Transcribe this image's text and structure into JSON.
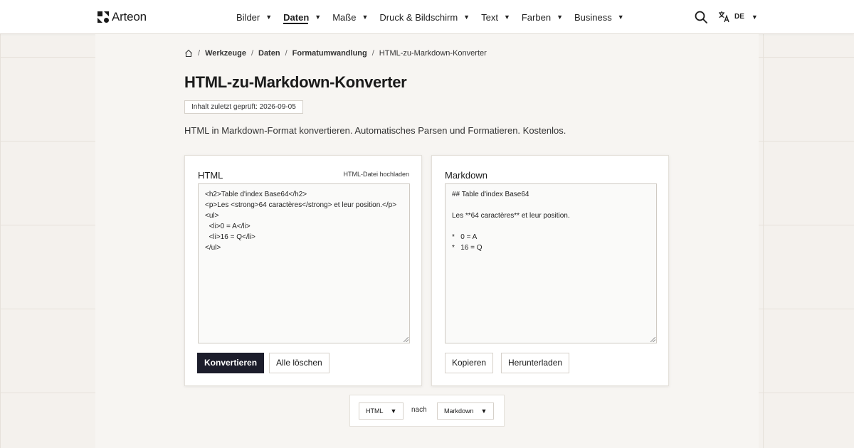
{
  "header": {
    "brand": "Arteon",
    "nav": [
      {
        "label": "Bilder",
        "active": false
      },
      {
        "label": "Daten",
        "active": true
      },
      {
        "label": "Maße",
        "active": false
      },
      {
        "label": "Druck & Bildschirm",
        "active": false
      },
      {
        "label": "Text",
        "active": false
      },
      {
        "label": "Farben",
        "active": false
      },
      {
        "label": "Business",
        "active": false
      }
    ],
    "language": "DE",
    "icons": {
      "search": "search-icon",
      "translate": "translate-icon",
      "caret": "▼"
    }
  },
  "breadcrumb": {
    "home_icon": "home-icon",
    "items": [
      "Werkzeuge",
      "Daten",
      "Formatumwandlung"
    ],
    "current": "HTML-zu-Markdown-Konverter"
  },
  "page": {
    "title": "HTML-zu-Markdown-Konverter",
    "checked_badge": "Inhalt zuletzt geprüft: 2026-09-05",
    "description": "HTML in Markdown-Format konvertieren. Automatisches Parsen und Formatieren. Kostenlos."
  },
  "input_panel": {
    "label": "HTML",
    "upload_link": "HTML-Datei hochladen",
    "value": "<h2>Table d'index Base64</h2>\n<p>Les <strong>64 caractères</strong> et leur position.</p>\n<ul>\n  <li>0 = A</li>\n  <li>16 = Q</li>\n</ul>",
    "convert_button": "Konvertieren",
    "clear_button": "Alle löschen"
  },
  "output_panel": {
    "label": "Markdown",
    "value": "## Table d'index Base64\n\nLes **64 caractères** et leur position.\n\n*   0 = A\n*   16 = Q",
    "copy_button": "Kopieren",
    "download_button": "Herunterladen"
  },
  "converter": {
    "from": "HTML",
    "connector": "nach",
    "to": "Markdown"
  },
  "colors": {
    "primary_button": "#1c1d2b",
    "background": "#f4f1ed",
    "panel": "#f7f5f2"
  }
}
